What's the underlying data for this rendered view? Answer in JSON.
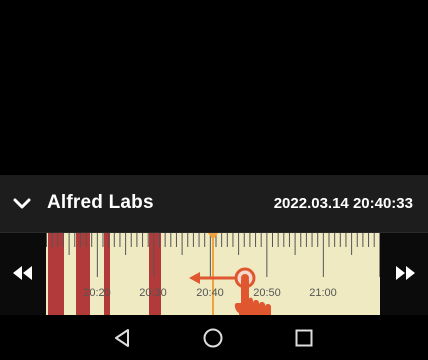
{
  "header": {
    "title": "Alfred Labs",
    "timestamp": "2022.03.14 20:40:33"
  },
  "timeline": {
    "tick_labels": [
      "20:20",
      "20:30",
      "20:40",
      "20:50",
      "21:00"
    ],
    "playhead_time": "20:40:33",
    "recorded_segments_color": "#b23a3a",
    "track_color": "#efeac2",
    "playhead_color": "#f0a23c"
  },
  "gesture": {
    "hint": "swipe-left",
    "color": "#e0572f"
  },
  "icons": {
    "collapse": "chevron-down-icon",
    "rewind": "rewind-icon",
    "forward": "fast-forward-icon",
    "back": "back-icon",
    "home": "home-icon",
    "recents": "recents-icon"
  }
}
